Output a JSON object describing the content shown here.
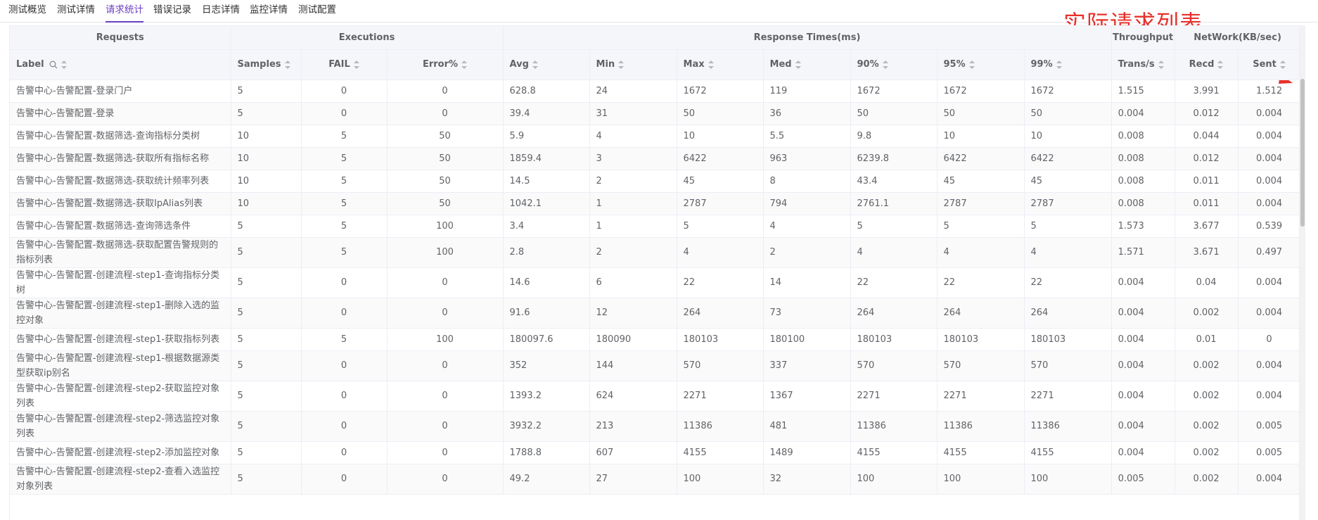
{
  "tabs": [
    "测试概览",
    "测试详情",
    "请求统计",
    "错误记录",
    "日志详情",
    "监控详情",
    "测试配置"
  ],
  "active_tab": "请求统计",
  "annotation": "实际请求列表",
  "groups": {
    "requests": "Requests",
    "executions": "Executions",
    "response_times": "Response Times(ms)",
    "throughput": "Throughput",
    "network": "NetWork(KB/sec)"
  },
  "columns": {
    "label": "Label",
    "samples": "Samples",
    "fail": "FAIL",
    "error": "Error%",
    "avg": "Avg",
    "min": "Min",
    "max": "Max",
    "med": "Med",
    "p90": "90%",
    "p95": "95%",
    "p99": "99%",
    "trans": "Trans/s",
    "recd": "Recd",
    "sent": "Sent"
  },
  "rows": [
    {
      "label": "告警中心-告警配置-登录门户",
      "samples": "5",
      "fail": "0",
      "error": "0",
      "avg": "628.8",
      "min": "24",
      "max": "1672",
      "med": "119",
      "p90": "1672",
      "p95": "1672",
      "p99": "1672",
      "trans": "1.515",
      "recd": "3.991",
      "sent": "1.512"
    },
    {
      "label": "告警中心-告警配置-登录",
      "samples": "5",
      "fail": "0",
      "error": "0",
      "avg": "39.4",
      "min": "31",
      "max": "50",
      "med": "36",
      "p90": "50",
      "p95": "50",
      "p99": "50",
      "trans": "0.004",
      "recd": "0.012",
      "sent": "0.004"
    },
    {
      "label": "告警中心-告警配置-数据筛选-查询指标分类树",
      "samples": "10",
      "fail": "5",
      "error": "50",
      "avg": "5.9",
      "min": "4",
      "max": "10",
      "med": "5.5",
      "p90": "9.8",
      "p95": "10",
      "p99": "10",
      "trans": "0.008",
      "recd": "0.044",
      "sent": "0.004"
    },
    {
      "label": "告警中心-告警配置-数据筛选-获取所有指标名称",
      "samples": "10",
      "fail": "5",
      "error": "50",
      "avg": "1859.4",
      "min": "3",
      "max": "6422",
      "med": "963",
      "p90": "6239.8",
      "p95": "6422",
      "p99": "6422",
      "trans": "0.008",
      "recd": "0.012",
      "sent": "0.004"
    },
    {
      "label": "告警中心-告警配置-数据筛选-获取统计频率列表",
      "samples": "10",
      "fail": "5",
      "error": "50",
      "avg": "14.5",
      "min": "2",
      "max": "45",
      "med": "8",
      "p90": "43.4",
      "p95": "45",
      "p99": "45",
      "trans": "0.008",
      "recd": "0.011",
      "sent": "0.004"
    },
    {
      "label": "告警中心-告警配置-数据筛选-获取IpAlias列表",
      "samples": "10",
      "fail": "5",
      "error": "50",
      "avg": "1042.1",
      "min": "1",
      "max": "2787",
      "med": "794",
      "p90": "2761.1",
      "p95": "2787",
      "p99": "2787",
      "trans": "0.008",
      "recd": "0.011",
      "sent": "0.004"
    },
    {
      "label": "告警中心-告警配置-数据筛选-查询筛选条件",
      "samples": "5",
      "fail": "5",
      "error": "100",
      "avg": "3.4",
      "min": "1",
      "max": "5",
      "med": "4",
      "p90": "5",
      "p95": "5",
      "p99": "5",
      "trans": "1.573",
      "recd": "3.677",
      "sent": "0.539"
    },
    {
      "label": "告警中心-告警配置-数据筛选-获取配置告警规则的指标列表",
      "samples": "5",
      "fail": "5",
      "error": "100",
      "avg": "2.8",
      "min": "2",
      "max": "4",
      "med": "2",
      "p90": "4",
      "p95": "4",
      "p99": "4",
      "trans": "1.571",
      "recd": "3.671",
      "sent": "0.497"
    },
    {
      "label": "告警中心-告警配置-创建流程-step1-查询指标分类树",
      "samples": "5",
      "fail": "0",
      "error": "0",
      "avg": "14.6",
      "min": "6",
      "max": "22",
      "med": "14",
      "p90": "22",
      "p95": "22",
      "p99": "22",
      "trans": "0.004",
      "recd": "0.04",
      "sent": "0.004"
    },
    {
      "label": "告警中心-告警配置-创建流程-step1-删除入选的监控对象",
      "samples": "5",
      "fail": "0",
      "error": "0",
      "avg": "91.6",
      "min": "12",
      "max": "264",
      "med": "73",
      "p90": "264",
      "p95": "264",
      "p99": "264",
      "trans": "0.004",
      "recd": "0.002",
      "sent": "0.004"
    },
    {
      "label": "告警中心-告警配置-创建流程-step1-获取指标列表",
      "samples": "5",
      "fail": "5",
      "error": "100",
      "avg": "180097.6",
      "min": "180090",
      "max": "180103",
      "med": "180100",
      "p90": "180103",
      "p95": "180103",
      "p99": "180103",
      "trans": "0.004",
      "recd": "0.01",
      "sent": "0"
    },
    {
      "label": "告警中心-告警配置-创建流程-step1-根据数据源类型获取ip别名",
      "samples": "5",
      "fail": "0",
      "error": "0",
      "avg": "352",
      "min": "144",
      "max": "570",
      "med": "337",
      "p90": "570",
      "p95": "570",
      "p99": "570",
      "trans": "0.004",
      "recd": "0.002",
      "sent": "0.004"
    },
    {
      "label": "告警中心-告警配置-创建流程-step2-获取监控对象列表",
      "samples": "5",
      "fail": "0",
      "error": "0",
      "avg": "1393.2",
      "min": "624",
      "max": "2271",
      "med": "1367",
      "p90": "2271",
      "p95": "2271",
      "p99": "2271",
      "trans": "0.004",
      "recd": "0.002",
      "sent": "0.004"
    },
    {
      "label": "告警中心-告警配置-创建流程-step2-筛选监控对象列表",
      "samples": "5",
      "fail": "0",
      "error": "0",
      "avg": "3932.2",
      "min": "213",
      "max": "11386",
      "med": "481",
      "p90": "11386",
      "p95": "11386",
      "p99": "11386",
      "trans": "0.004",
      "recd": "0.002",
      "sent": "0.005"
    },
    {
      "label": "告警中心-告警配置-创建流程-step2-添加监控对象",
      "samples": "5",
      "fail": "0",
      "error": "0",
      "avg": "1788.8",
      "min": "607",
      "max": "4155",
      "med": "1489",
      "p90": "4155",
      "p95": "4155",
      "p99": "4155",
      "trans": "0.004",
      "recd": "0.002",
      "sent": "0.005"
    },
    {
      "label": "告警中心-告警配置-创建流程-step2-查看入选监控对象列表",
      "samples": "5",
      "fail": "0",
      "error": "0",
      "avg": "49.2",
      "min": "27",
      "max": "100",
      "med": "32",
      "p90": "100",
      "p95": "100",
      "p99": "100",
      "trans": "0.005",
      "recd": "0.002",
      "sent": "0.004"
    }
  ]
}
